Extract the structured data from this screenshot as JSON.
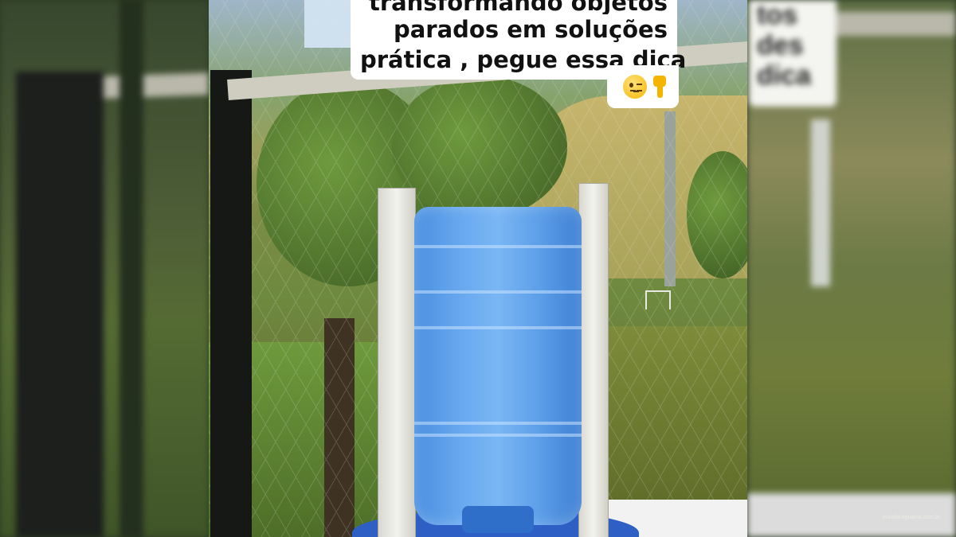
{
  "caption": {
    "lines": [
      "transformando objetos",
      "parados em soluções",
      "prática , pegue essa dica"
    ],
    "emojis": [
      "winking-face-emoji",
      "backhand-index-pointing-down-emoji"
    ]
  },
  "side_panel_ghost": {
    "lines": [
      "tos",
      "des",
      "dica"
    ]
  },
  "watermark": "portalaraguaina.com.br",
  "colors": {
    "jug_blue": "#5c9ee8",
    "caption_bg": "#ffffff",
    "caption_text": "#111111"
  }
}
